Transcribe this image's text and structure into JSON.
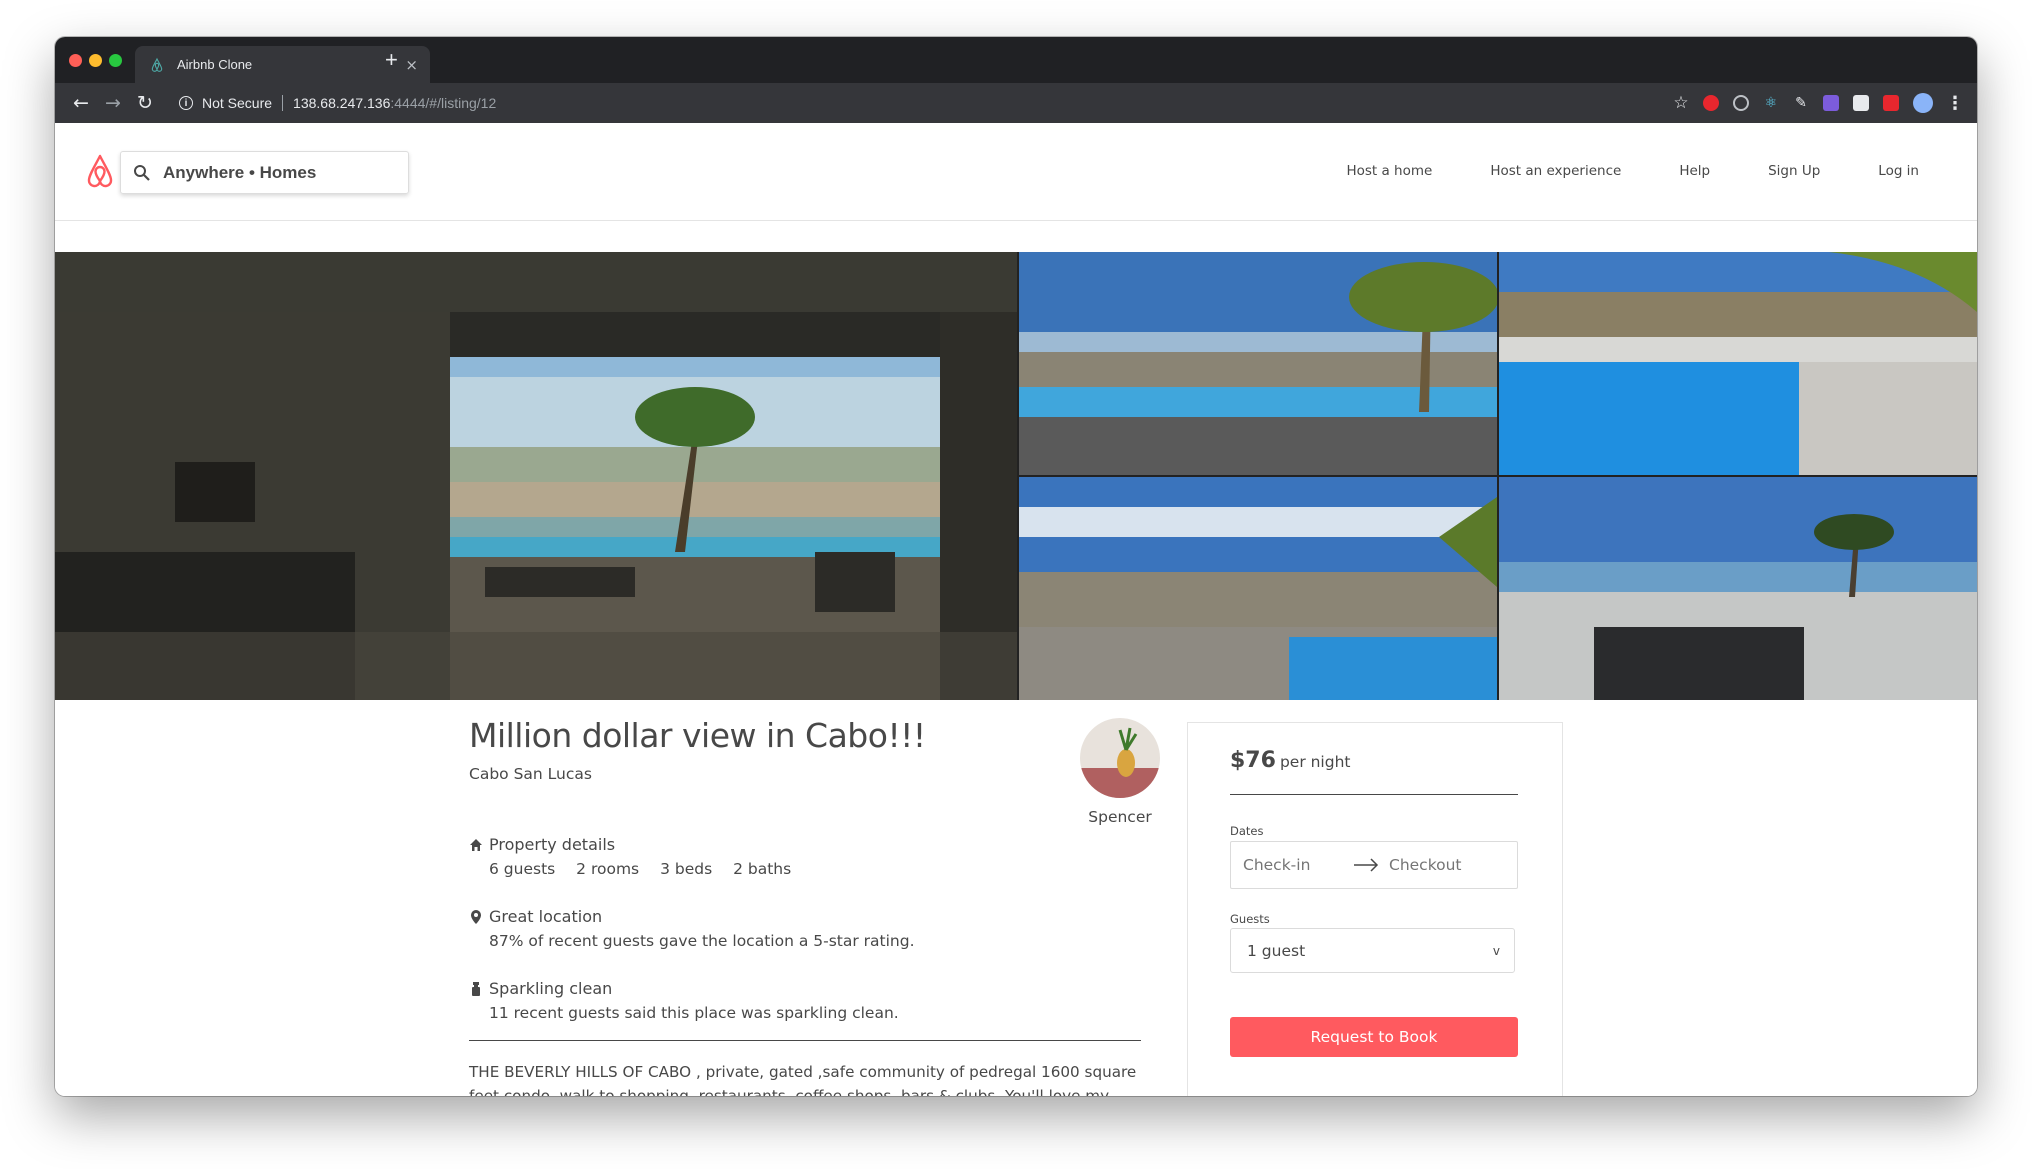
{
  "browser": {
    "tab_title": "Airbnb Clone",
    "tab_close": "×",
    "new_tab": "+",
    "security_label": "Not Secure",
    "url_host": "138.68.247.136",
    "url_path": ":4444/#/listing/12",
    "icons": [
      "back-icon",
      "forward-icon",
      "reload-icon",
      "info-icon",
      "star-icon",
      "menu-icon"
    ]
  },
  "header": {
    "search_text": "Anywhere • Homes",
    "nav": [
      "Host a home",
      "Host an experience",
      "Help",
      "Sign Up",
      "Log in"
    ],
    "brand_color": "#ff5a5f"
  },
  "listing": {
    "title": "Million dollar view in Cabo!!!",
    "city": "Cabo San Lucas",
    "host_name": "Spencer",
    "property_heading": "Property details",
    "stats": [
      "6 guests",
      "2 rooms",
      "3 beds",
      "2 baths"
    ],
    "location_heading": "Great location",
    "location_body": "87% of recent guests gave the location a 5-star rating.",
    "clean_heading": "Sparkling clean",
    "clean_body": "11 recent guests said this place was sparkling clean.",
    "description": "THE BEVERLY HILLS OF CABO , private, gated ,safe community of pedregal 1600 square feet condo, walk to shopping, restaurants, coffee shops, bars & clubs. You'll love my place because of the amazing view and perfect location. ALSO NOW AVAILABLE,CONDO RIGHT"
  },
  "booking": {
    "price": "$76",
    "per_night": "per night",
    "dates_label": "Dates",
    "checkin_placeholder": "Check-in",
    "checkout_placeholder": "Checkout",
    "guests_label": "Guests",
    "guests_value": "1 guest",
    "guests_chevron": "v",
    "button_label": "Request to Book"
  }
}
